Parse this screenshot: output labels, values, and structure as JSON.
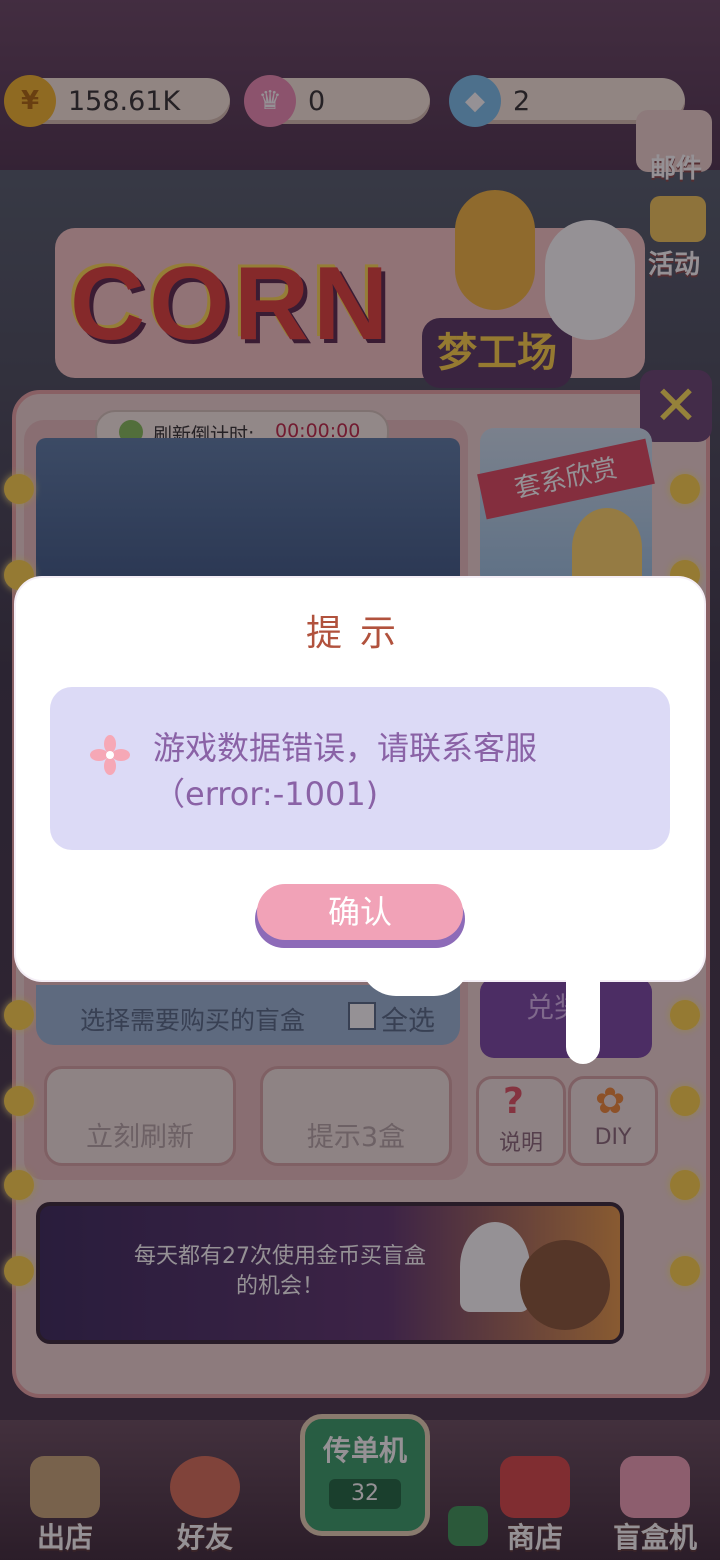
{
  "resources": {
    "coins": "158.61K",
    "crowns": "0",
    "gems": "2"
  },
  "side_menu": {
    "mail_label": "邮件",
    "events_label": "活动"
  },
  "machine": {
    "logo": "CORN",
    "logo_sub": "梦工场",
    "refresh_label": "刷新倒计时:",
    "refresh_time": "00:00:00",
    "series_label": "套系欣赏",
    "select_label": "选择需要购买的盲盒",
    "select_all_label": "全选",
    "redeem_label": "兑奖",
    "refresh_now_label": "立刻刷新",
    "hint_label": "提示3盒",
    "help_label": "说明",
    "diy_label": "DIY",
    "banner_text": "每天都有27次使用金币买盲盒的机会！"
  },
  "bottom_nav": {
    "exit_label": "出店",
    "friends_label": "好友",
    "flyer_label": "传单机",
    "flyer_count": "32",
    "shop_label": "商店",
    "blindbox_label": "盲盒机"
  },
  "dialog": {
    "title": "提示",
    "message": "游戏数据错误，请联系客服（error:-1001)",
    "confirm_label": "确认"
  },
  "colors": {
    "dialog_title": "#b1523d",
    "message_text": "#8a62a6",
    "message_bg": "#dcdaf6",
    "confirm_button": "#f1a2b7"
  }
}
